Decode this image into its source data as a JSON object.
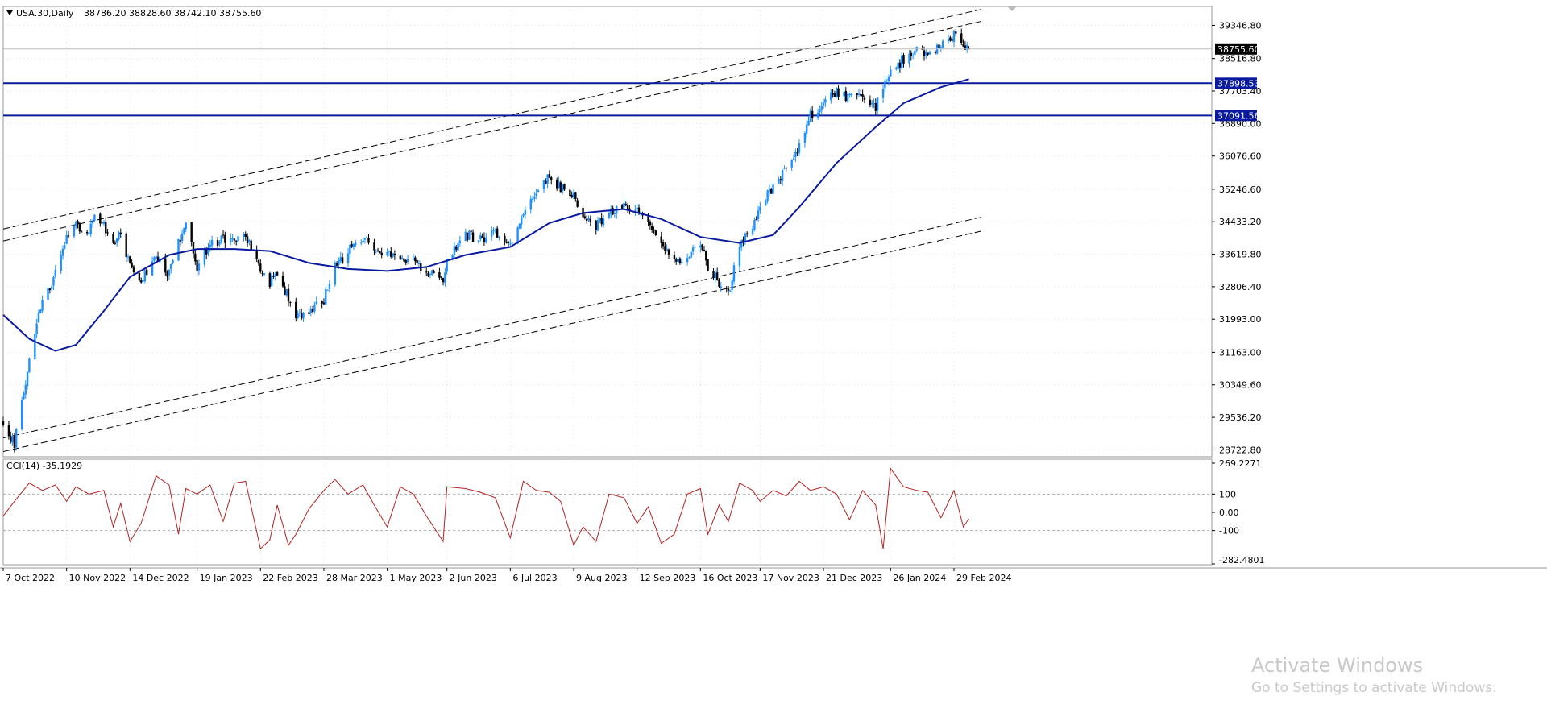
{
  "header": {
    "symbol": "USA.30,Daily",
    "ohlc": "38786.20 38828.60 38742.10 38755.60"
  },
  "colors": {
    "bull": "#1e90ff",
    "bear": "#000000",
    "ma": "#0a1a9e",
    "hline": "#0a1a9e",
    "cci": "#b22222",
    "grid": "#c8c8c8"
  },
  "chart_data": [
    {
      "type": "candlestick",
      "title": "USA.30,Daily",
      "x_ticks": [
        "7 Oct 2022",
        "10 Nov 2022",
        "14 Dec 2022",
        "19 Jan 2023",
        "22 Feb 2023",
        "28 Mar 2023",
        "1 May 2023",
        "2 Jun 2023",
        "6 Jul 2023",
        "9 Aug 2023",
        "12 Sep 2023",
        "16 Oct 2023",
        "17 Nov 2023",
        "21 Dec 2023",
        "26 Jan 2024",
        "29 Feb 2024"
      ],
      "y_ticks": [
        "39346.80",
        "38516.80",
        "37703.40",
        "36890.00",
        "36076.60",
        "35246.60",
        "34433.20",
        "33619.80",
        "32806.40",
        "31993.00",
        "31163.00",
        "30349.60",
        "29536.20",
        "28722.80"
      ],
      "ylim": [
        28550,
        39820
      ],
      "last_price": "38755.60",
      "horizontal_lines": [
        "37898.53",
        "37091.56"
      ],
      "close_path": [
        [
          "7 Oct 2022",
          29300
        ],
        [
          "13 Oct 2022",
          28900
        ],
        [
          "21 Oct 2022",
          31000
        ],
        [
          "28 Oct 2022",
          32500
        ],
        [
          "4 Nov 2022",
          33100
        ],
        [
          "10 Nov 2022",
          34000
        ],
        [
          "15 Nov 2022",
          34400
        ],
        [
          "22 Nov 2022",
          34100
        ],
        [
          "25 Nov 2022",
          34600
        ],
        [
          "30 Nov 2022",
          34300
        ],
        [
          "5 Dec 2022",
          33800
        ],
        [
          "9 Dec 2022",
          34200
        ],
        [
          "14 Dec 2022",
          33300
        ],
        [
          "20 Dec 2022",
          33000
        ],
        [
          "28 Dec 2022",
          33500
        ],
        [
          "4 Jan 2023",
          33100
        ],
        [
          "9 Jan 2023",
          33900
        ],
        [
          "13 Jan 2023",
          34300
        ],
        [
          "19 Jan 2023",
          33300
        ],
        [
          "26 Jan 2023",
          33900
        ],
        [
          "2 Feb 2023",
          34000
        ],
        [
          "8 Feb 2023",
          33900
        ],
        [
          "14 Feb 2023",
          34100
        ],
        [
          "22 Feb 2023",
          33300
        ],
        [
          "27 Feb 2023",
          32900
        ],
        [
          "3 Mar 2023",
          33200
        ],
        [
          "9 Mar 2023",
          32500
        ],
        [
          "13 Mar 2023",
          32000
        ],
        [
          "20 Mar 2023",
          32200
        ],
        [
          "28 Mar 2023",
          32500
        ],
        [
          "3 Apr 2023",
          33300
        ],
        [
          "10 Apr 2023",
          33700
        ],
        [
          "18 Apr 2023",
          34000
        ],
        [
          "24 Apr 2023",
          33800
        ],
        [
          "1 May 2023",
          33600
        ],
        [
          "8 May 2023",
          33600
        ],
        [
          "15 May 2023",
          33400
        ],
        [
          "22 May 2023",
          33200
        ],
        [
          "31 May 2023",
          33000
        ],
        [
          "2 Jun 2023",
          33500
        ],
        [
          "12 Jun 2023",
          34100
        ],
        [
          "20 Jun 2023",
          34000
        ],
        [
          "28 Jun 2023",
          34200
        ],
        [
          "6 Jul 2023",
          33900
        ],
        [
          "13 Jul 2023",
          34600
        ],
        [
          "20 Jul 2023",
          35200
        ],
        [
          "27 Jul 2023",
          35600
        ],
        [
          "2 Aug 2023",
          35300
        ],
        [
          "9 Aug 2023",
          35100
        ],
        [
          "14 Aug 2023",
          34600
        ],
        [
          "21 Aug 2023",
          34300
        ],
        [
          "28 Aug 2023",
          34700
        ],
        [
          "5 Sep 2023",
          34800
        ],
        [
          "12 Sep 2023",
          34700
        ],
        [
          "18 Sep 2023",
          34400
        ],
        [
          "25 Sep 2023",
          33800
        ],
        [
          "2 Oct 2023",
          33400
        ],
        [
          "9 Oct 2023",
          33600
        ],
        [
          "16 Oct 2023",
          33900
        ],
        [
          "20 Oct 2023",
          33300
        ],
        [
          "26 Oct 2023",
          32900
        ],
        [
          "31 Oct 2023",
          32600
        ],
        [
          "6 Nov 2023",
          33900
        ],
        [
          "13 Nov 2023",
          34200
        ],
        [
          "17 Nov 2023",
          34800
        ],
        [
          "24 Nov 2023",
          35300
        ],
        [
          "1 Dec 2023",
          35800
        ],
        [
          "8 Dec 2023",
          36300
        ],
        [
          "14 Dec 2023",
          37100
        ],
        [
          "21 Dec 2023",
          37400
        ],
        [
          "28 Dec 2023",
          37700
        ],
        [
          "4 Jan 2024",
          37500
        ],
        [
          "11 Jan 2024",
          37600
        ],
        [
          "18 Jan 2024",
          37300
        ],
        [
          "22 Jan 2024",
          37800
        ],
        [
          "26 Jan 2024",
          38200
        ],
        [
          "2 Feb 2024",
          38500
        ],
        [
          "9 Feb 2024",
          38700
        ],
        [
          "15 Feb 2024",
          38600
        ],
        [
          "22 Feb 2024",
          38900
        ],
        [
          "29 Feb 2024",
          39100
        ],
        [
          "5 Mar 2024",
          38900
        ],
        [
          "8 Mar 2024",
          38755.6
        ]
      ],
      "ma_path": [
        [
          "7 Oct 2022",
          32100
        ],
        [
          "21 Oct 2022",
          31500
        ],
        [
          "4 Nov 2022",
          31200
        ],
        [
          "15 Nov 2022",
          31350
        ],
        [
          "30 Nov 2022",
          32200
        ],
        [
          "14 Dec 2022",
          33050
        ],
        [
          "4 Jan 2023",
          33600
        ],
        [
          "19 Jan 2023",
          33750
        ],
        [
          "8 Feb 2023",
          33750
        ],
        [
          "27 Feb 2023",
          33700
        ],
        [
          "20 Mar 2023",
          33400
        ],
        [
          "10 Apr 2023",
          33250
        ],
        [
          "1 May 2023",
          33200
        ],
        [
          "22 May 2023",
          33300
        ],
        [
          "12 Jun 2023",
          33600
        ],
        [
          "6 Jul 2023",
          33800
        ],
        [
          "27 Jul 2023",
          34400
        ],
        [
          "14 Aug 2023",
          34650
        ],
        [
          "5 Sep 2023",
          34750
        ],
        [
          "25 Sep 2023",
          34500
        ],
        [
          "16 Oct 2023",
          34050
        ],
        [
          "6 Nov 2023",
          33900
        ],
        [
          "24 Nov 2023",
          34100
        ],
        [
          "8 Dec 2023",
          34800
        ],
        [
          "28 Dec 2023",
          35900
        ],
        [
          "18 Jan 2024",
          36800
        ],
        [
          "2 Feb 2024",
          37400
        ],
        [
          "22 Feb 2024",
          37800
        ],
        [
          "8 Mar 2024",
          38000
        ]
      ],
      "channels": [
        {
          "from": [
            "7 Oct 2022",
            34250
          ],
          "to": [
            "15 Mar 2024",
            39750
          ]
        },
        {
          "from": [
            "7 Oct 2022",
            33950
          ],
          "to": [
            "15 Mar 2024",
            39450
          ]
        },
        {
          "from": [
            "7 Oct 2022",
            29020
          ],
          "to": [
            "15 Mar 2024",
            34550
          ]
        },
        {
          "from": [
            "7 Oct 2022",
            28680
          ],
          "to": [
            "15 Mar 2024",
            34200
          ]
        }
      ]
    },
    {
      "type": "line",
      "title": "CCI(14) -35.1929",
      "y_ticks": [
        "269.2271",
        "100",
        "0.00",
        "-100",
        "-282.4801"
      ],
      "ylim": [
        -282.4801,
        269.2271
      ],
      "levels": [
        100,
        -100
      ],
      "x": [
        "7 Oct 2022",
        "13 Oct 2022",
        "21 Oct 2022",
        "28 Oct 2022",
        "4 Nov 2022",
        "10 Nov 2022",
        "15 Nov 2022",
        "22 Nov 2022",
        "30 Nov 2022",
        "5 Dec 2022",
        "9 Dec 2022",
        "14 Dec 2022",
        "20 Dec 2022",
        "28 Dec 2022",
        "4 Jan 2023",
        "9 Jan 2023",
        "13 Jan 2023",
        "19 Jan 2023",
        "26 Jan 2023",
        "2 Feb 2023",
        "8 Feb 2023",
        "14 Feb 2023",
        "22 Feb 2023",
        "27 Feb 2023",
        "3 Mar 2023",
        "9 Mar 2023",
        "13 Mar 2023",
        "20 Mar 2023",
        "28 Mar 2023",
        "3 Apr 2023",
        "10 Apr 2023",
        "18 Apr 2023",
        "24 Apr 2023",
        "1 May 2023",
        "8 May 2023",
        "15 May 2023",
        "22 May 2023",
        "31 May 2023",
        "2 Jun 2023",
        "12 Jun 2023",
        "20 Jun 2023",
        "28 Jun 2023",
        "6 Jul 2023",
        "13 Jul 2023",
        "20 Jul 2023",
        "27 Jul 2023",
        "2 Aug 2023",
        "9 Aug 2023",
        "14 Aug 2023",
        "21 Aug 2023",
        "28 Aug 2023",
        "5 Sep 2023",
        "12 Sep 2023",
        "18 Sep 2023",
        "25 Sep 2023",
        "2 Oct 2023",
        "9 Oct 2023",
        "16 Oct 2023",
        "20 Oct 2023",
        "26 Oct 2023",
        "31 Oct 2023",
        "6 Nov 2023",
        "13 Nov 2023",
        "17 Nov 2023",
        "24 Nov 2023",
        "1 Dec 2023",
        "8 Dec 2023",
        "14 Dec 2023",
        "21 Dec 2023",
        "28 Dec 2023",
        "4 Jan 2024",
        "11 Jan 2024",
        "18 Jan 2024",
        "22 Jan 2024",
        "26 Jan 2024",
        "2 Feb 2024",
        "9 Feb 2024",
        "15 Feb 2024",
        "22 Feb 2024",
        "29 Feb 2024",
        "5 Mar 2024",
        "8 Mar 2024"
      ],
      "values": [
        -20,
        60,
        160,
        120,
        150,
        60,
        140,
        100,
        120,
        -80,
        50,
        -160,
        -60,
        200,
        150,
        -120,
        130,
        100,
        150,
        -50,
        160,
        170,
        -200,
        -150,
        40,
        -180,
        -120,
        20,
        120,
        180,
        100,
        150,
        40,
        -80,
        140,
        100,
        -20,
        -160,
        140,
        130,
        110,
        80,
        -140,
        170,
        120,
        110,
        60,
        -180,
        -80,
        -160,
        100,
        80,
        -60,
        30,
        -170,
        -120,
        100,
        130,
        -120,
        40,
        -50,
        160,
        120,
        60,
        120,
        90,
        170,
        120,
        140,
        100,
        -40,
        120,
        40,
        -200,
        240,
        140,
        120,
        110,
        -30,
        120,
        -80,
        -35.19
      ]
    }
  ],
  "watermark": {
    "title": "Activate Windows",
    "subtitle": "Go to Settings to activate Windows."
  }
}
